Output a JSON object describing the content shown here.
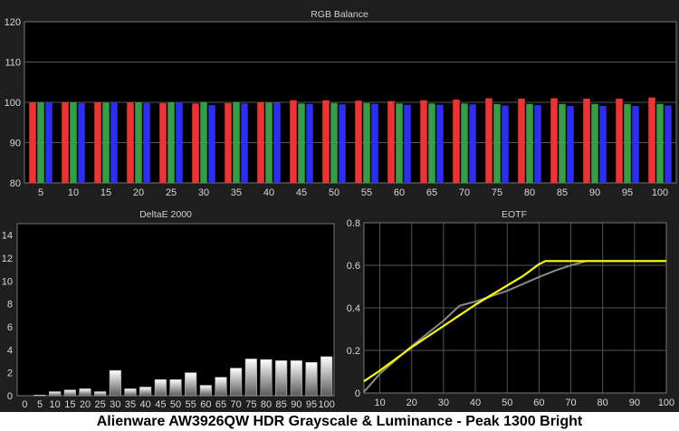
{
  "caption": "Alienware AW3926QW HDR Grayscale & Luminance - Peak 1300 Bright",
  "colors": {
    "frame": "#1e1e1e",
    "plot_bg": "#000000",
    "grid": "#555555",
    "red": "#ee3333",
    "green": "#33a045",
    "blue": "#2e2ef0",
    "target": "#8a8a8a",
    "measured": "#ffff00"
  },
  "chart_data": [
    {
      "type": "bar",
      "title": "RGB Balance",
      "categories": [
        "5",
        "10",
        "15",
        "20",
        "25",
        "30",
        "35",
        "40",
        "45",
        "50",
        "55",
        "60",
        "65",
        "70",
        "75",
        "80",
        "85",
        "90",
        "95",
        "100"
      ],
      "ylim": [
        80,
        120
      ],
      "yticks": [
        80,
        90,
        100,
        110,
        120
      ],
      "grid": true,
      "series": [
        {
          "color": "red",
          "values": [
            100.0,
            100.0,
            100.0,
            99.9,
            99.8,
            99.7,
            99.8,
            100.0,
            100.5,
            100.5,
            100.4,
            100.3,
            100.5,
            100.7,
            101.0,
            100.9,
            101.0,
            100.9,
            100.9,
            101.2
          ]
        },
        {
          "color": "green",
          "values": [
            100.0,
            100.0,
            99.9,
            100.0,
            100.0,
            100.1,
            100.1,
            99.9,
            99.7,
            99.8,
            99.8,
            99.7,
            99.7,
            99.7,
            99.6,
            99.6,
            99.6,
            99.6,
            99.6,
            99.6
          ]
        },
        {
          "color": "blue",
          "values": [
            100.0,
            99.8,
            100.0,
            99.8,
            100.0,
            99.3,
            99.7,
            99.9,
            99.6,
            99.5,
            99.6,
            99.4,
            99.4,
            99.5,
            99.2,
            99.3,
            99.1,
            99.1,
            99.1,
            99.2
          ]
        }
      ]
    },
    {
      "type": "bar",
      "title": "DeltaE 2000",
      "categories": [
        "0",
        "5",
        "10",
        "15",
        "20",
        "25",
        "30",
        "35",
        "40",
        "45",
        "50",
        "55",
        "60",
        "65",
        "70",
        "75",
        "80",
        "85",
        "90",
        "95",
        "100"
      ],
      "values": [
        0.05,
        0.35,
        0.5,
        0.6,
        0.35,
        2.2,
        0.6,
        0.75,
        1.4,
        1.4,
        2.0,
        0.9,
        1.6,
        2.4,
        3.2,
        3.15,
        3.05,
        3.05,
        2.9,
        3.4
      ],
      "bar_categories": [
        "5",
        "10",
        "15",
        "20",
        "25",
        "30",
        "35",
        "40",
        "45",
        "50",
        "55",
        "60",
        "65",
        "70",
        "75",
        "80",
        "85",
        "90",
        "95",
        "100"
      ],
      "ylim": [
        0,
        15
      ],
      "yticks": [
        0,
        2,
        4,
        6,
        8,
        10,
        12,
        14
      ],
      "grid": false
    },
    {
      "type": "line",
      "title": "EOTF",
      "xlim": [
        5,
        100
      ],
      "xticks": [
        10,
        20,
        30,
        40,
        50,
        60,
        70,
        80,
        90,
        100
      ],
      "ylim": [
        0,
        0.8
      ],
      "yticks": [
        0,
        0.2,
        0.4,
        0.6,
        0.8
      ],
      "grid": true,
      "series": [
        {
          "color": "target",
          "x": [
            5,
            10,
            20,
            30,
            35,
            40,
            50,
            60,
            65,
            70,
            75,
            80,
            100
          ],
          "y": [
            0.005,
            0.09,
            0.22,
            0.34,
            0.41,
            0.43,
            0.48,
            0.545,
            0.575,
            0.6,
            0.62,
            0.62,
            0.62
          ]
        },
        {
          "color": "measured",
          "x": [
            5,
            10,
            20,
            30,
            40,
            50,
            55,
            60,
            62,
            65,
            70,
            80,
            100
          ],
          "y": [
            0.055,
            0.105,
            0.215,
            0.315,
            0.415,
            0.505,
            0.55,
            0.605,
            0.62,
            0.62,
            0.62,
            0.62,
            0.62
          ]
        }
      ]
    }
  ]
}
